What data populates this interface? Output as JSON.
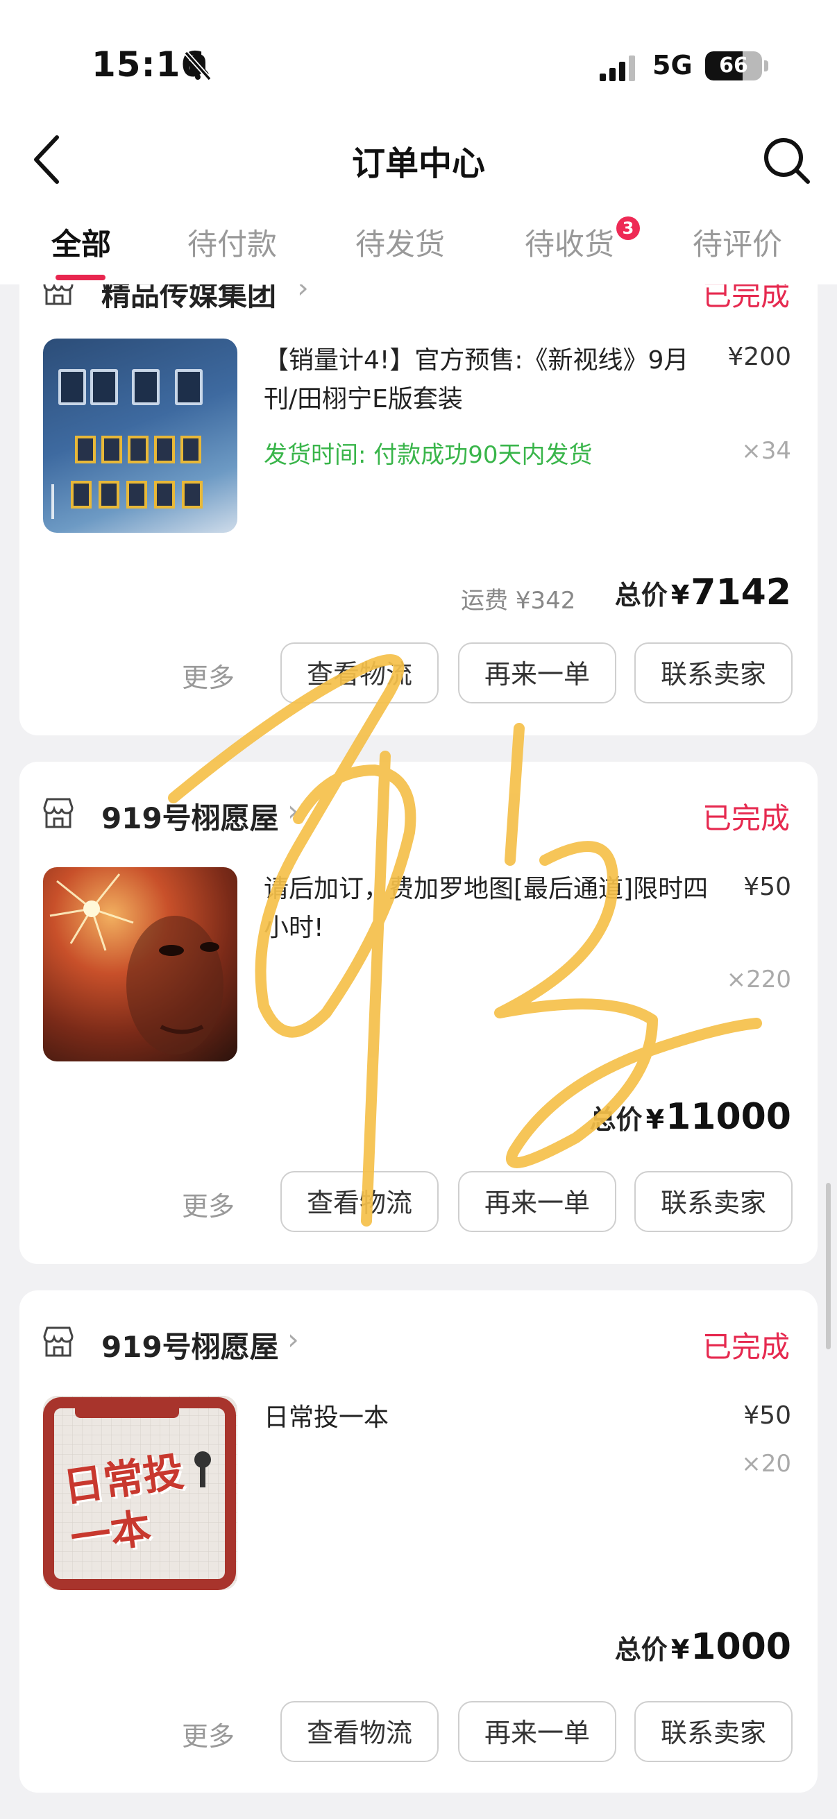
{
  "status_bar": {
    "time": "15:16",
    "network": "5G",
    "battery": "66",
    "battery_level": 0.66
  },
  "header": {
    "title": "订单中心"
  },
  "tabs": [
    {
      "label": "全部",
      "active": true
    },
    {
      "label": "待付款"
    },
    {
      "label": "待发货"
    },
    {
      "label": "待收货",
      "badge": "3"
    },
    {
      "label": "待评价"
    }
  ],
  "orders": [
    {
      "shop": "精品传媒集团",
      "status": "已完成",
      "title": "【销量计4!】官方预售:《新视线》9月刊/田栩宁E版套装",
      "ship_note": "发货时间: 付款成功90天内发货",
      "price": "¥200",
      "qty": "×34",
      "freight_label": "运费",
      "freight": "¥342",
      "total_label": "总价",
      "currency": "¥",
      "total": "7142",
      "actions": {
        "more": "更多",
        "logistics": "查看物流",
        "reorder": "再来一单",
        "contact": "联系卖家"
      }
    },
    {
      "shop": "919号栩愿屋",
      "status": "已完成",
      "title": "请后加订，费加罗地图[最后通道]限时四小时!",
      "price": "¥50",
      "qty": "×220",
      "total_label": "总价",
      "currency": "¥",
      "total": "11000",
      "actions": {
        "more": "更多",
        "logistics": "查看物流",
        "reorder": "再来一单",
        "contact": "联系卖家"
      }
    },
    {
      "shop": "919号栩愿屋",
      "status": "已完成",
      "title": "日常投一本",
      "price": "¥50",
      "qty": "×20",
      "total_label": "总价",
      "currency": "¥",
      "total": "1000",
      "thumb_text": "日常投一本",
      "actions": {
        "more": "更多",
        "logistics": "查看物流",
        "reorder": "再来一单",
        "contact": "联系卖家"
      }
    }
  ],
  "colors": {
    "accent": "#e6294f",
    "ship_green": "#39b54a",
    "signature": "#f5c04a"
  }
}
